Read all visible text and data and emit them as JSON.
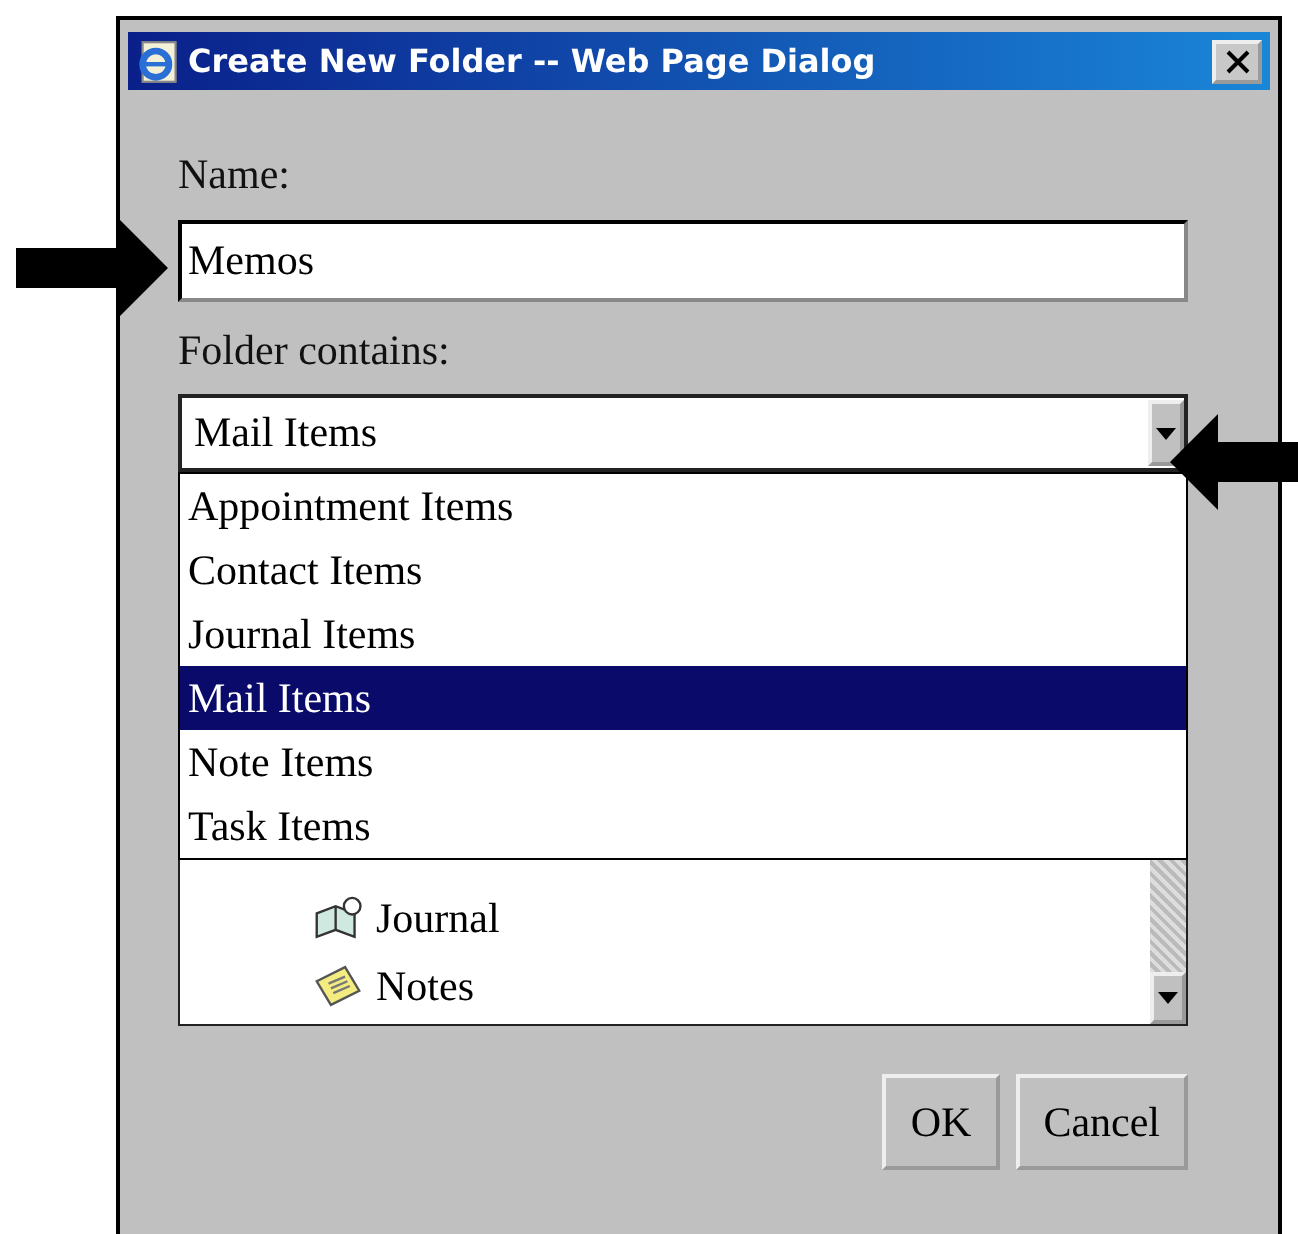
{
  "window": {
    "title": "Create New Folder -- Web Page Dialog"
  },
  "name_field": {
    "label": "Name:",
    "value": "Memos"
  },
  "folder_contains": {
    "label": "Folder contains:",
    "value": "Mail Items",
    "expanded": true,
    "options": [
      {
        "label": "Appointment Items",
        "selected": false
      },
      {
        "label": "Contact Items",
        "selected": false
      },
      {
        "label": "Journal Items",
        "selected": false
      },
      {
        "label": "Mail Items",
        "selected": true
      },
      {
        "label": "Note Items",
        "selected": false
      },
      {
        "label": "Task Items",
        "selected": false
      }
    ]
  },
  "folder_tree": {
    "items": [
      {
        "label": "Journal",
        "kind": "journal"
      },
      {
        "label": "Notes",
        "kind": "notes"
      }
    ]
  },
  "buttons": [
    {
      "label": "OK"
    },
    {
      "label": "Cancel"
    }
  ]
}
